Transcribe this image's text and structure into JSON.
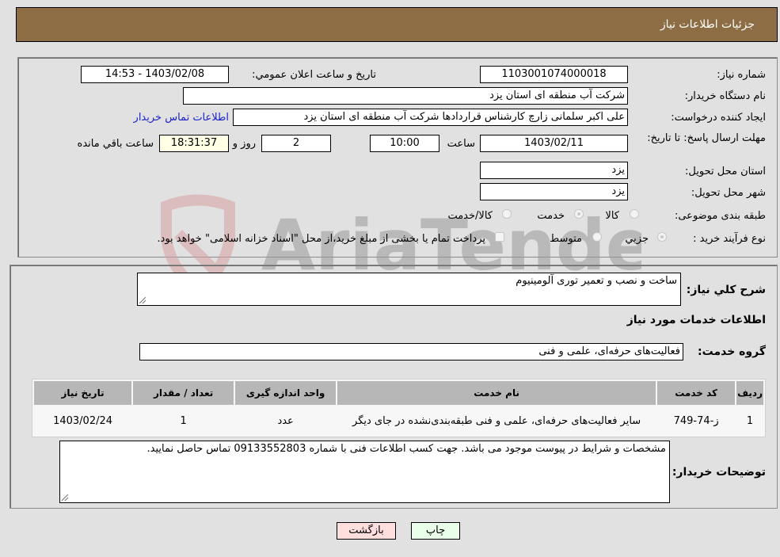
{
  "header": {
    "title": "جزئیات اطلاعات نیاز"
  },
  "form": {
    "need_number": {
      "label": "شماره نیاز:",
      "value": "1103001074000018"
    },
    "announce_datetime": {
      "label": "تاریخ و ساعت اعلان عمومي:",
      "value": "1403/02/08 - 14:53"
    },
    "buyer_org": {
      "label": "نام دستگاه خریدار:",
      "value": "شرکت آب منطقه ای استان یزد"
    },
    "requester": {
      "label": "ایجاد کننده درخواست:",
      "value": "علی اکبر سلمانی زارچ کارشناس قراردادها شرکت آب منطقه ای استان یزد"
    },
    "buyer_contact_link": "اطلاعات تماس خریدار",
    "deadline": {
      "label": "مهلت ارسال پاسخ: تا تاریخ:",
      "date": "1403/02/11",
      "time_label": "ساعت",
      "time": "10:00",
      "days": "2",
      "days_label": "روز و",
      "remaining": "18:31:37",
      "remaining_label": "ساعت باقي مانده"
    },
    "delivery_province": {
      "label": "استان محل تحویل:",
      "value": "یزد"
    },
    "delivery_city": {
      "label": "شهر محل تحویل:",
      "value": "یزد"
    },
    "category": {
      "label": "طبقه بندی موضوعی:",
      "options": [
        "کالا",
        "خدمت",
        "کالا/خدمت"
      ],
      "selected": "خدمت"
    },
    "purchase_type": {
      "label": "نوع فرآیند خرید :",
      "options": [
        "جزیي",
        "متوسط"
      ],
      "selected": "جزیي",
      "treasury_note": "پرداخت تمام یا بخشی از مبلغ خرید،از محل \"اسناد خزانه اسلامی\" خواهد بود."
    }
  },
  "details": {
    "summary_label": "شرح کلي نیاز:",
    "summary_value": "ساخت و نصب و تعمیر توری آلومینیوم",
    "services_heading": "اطلاعات خدمات مورد نیاز",
    "service_group_label": "گروه خدمت:",
    "service_group_value": "فعالیت‌های حرفه‌ای، علمی و فنی",
    "table": {
      "headers": [
        "ردیف",
        "کد خدمت",
        "نام خدمت",
        "واحد اندازه گیری",
        "تعداد / مقدار",
        "تاریخ نیاز"
      ],
      "rows": [
        [
          "1",
          "ز-74-749",
          "سایر فعالیت‌های حرفه‌ای، علمی و فنی طبقه‌بندی‌نشده در جای دیگر",
          "عدد",
          "1",
          "1403/02/24"
        ]
      ]
    },
    "buyer_notes_label": "توضیحات خریدار:",
    "buyer_notes_value": "مشخصات و شرایط در پیوست موجود می باشد. جهت کسب اطلاعات فنی با شماره 09133552803 تماس حاصل نمایید."
  },
  "buttons": {
    "print": "چاپ",
    "back": "بازگشت"
  },
  "watermark": {
    "text": "AriaTender.neT"
  },
  "colors": {
    "header_bg": "#8c6d44",
    "print_bg": "#eaffea",
    "back_bg": "#ffdede",
    "link": "#1b22c9"
  }
}
